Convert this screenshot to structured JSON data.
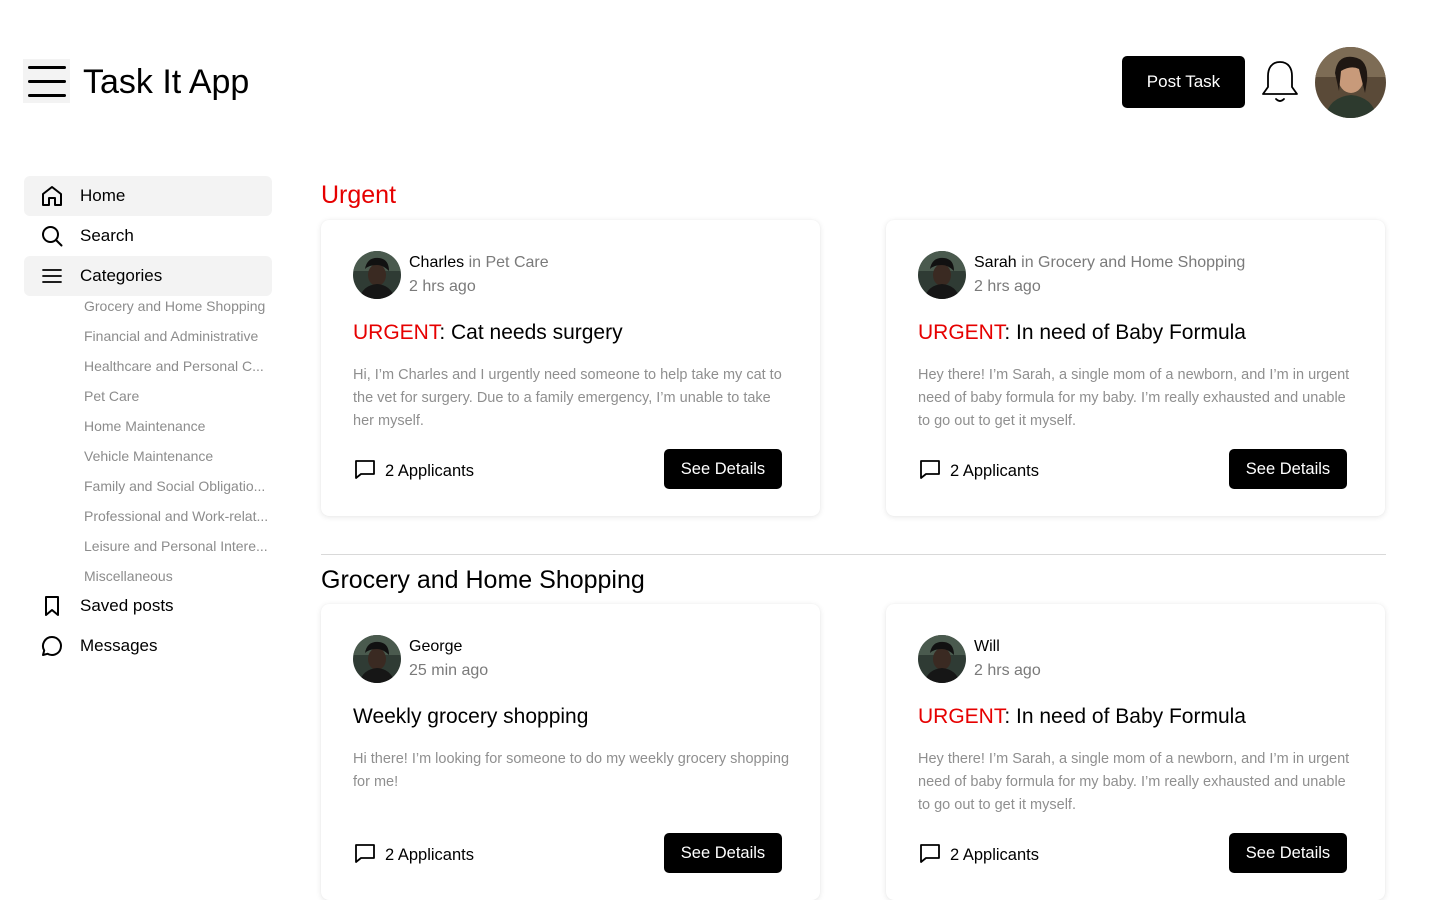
{
  "app": {
    "title": "Task It App"
  },
  "header": {
    "post_task_label": "Post Task"
  },
  "sidebar": {
    "items": [
      {
        "label": "Home",
        "icon": "home-icon"
      },
      {
        "label": "Search",
        "icon": "search-icon"
      },
      {
        "label": "Categories",
        "icon": "menu-icon"
      },
      {
        "label": "Saved posts",
        "icon": "bookmark-icon"
      },
      {
        "label": "Messages",
        "icon": "message-icon"
      }
    ],
    "categories": [
      "Grocery and Home Shopping",
      "Financial and Administrative",
      "Healthcare and Personal C...",
      "Pet Care",
      "Home Maintenance",
      "Vehicle Maintenance",
      "Family and Social Obligatio...",
      "Professional and Work-relat...",
      "Leisure and Personal Intere...",
      "Miscellaneous"
    ]
  },
  "sections": [
    {
      "title": "Urgent",
      "cards": [
        {
          "name": "Charles",
          "category": " in Pet Care",
          "time": "2 hrs ago",
          "urgent_prefix": "URGENT",
          "title": ": Cat needs surgery",
          "description": "Hi, I’m Charles and I urgently need someone to help take my cat to the vet for surgery. Due to a family emergency, I’m unable to take her myself.",
          "applicants": "2 Applicants",
          "button": "See Details"
        },
        {
          "name": "Sarah",
          "category": " in Grocery and Home Shopping",
          "time": "2 hrs ago",
          "urgent_prefix": "URGENT",
          "title": ": In need of Baby Formula",
          "description": "Hey there! I’m Sarah, a single mom of a newborn, and I’m in urgent need of baby formula for my baby. I’m really exhausted and unable to go out to get it myself.",
          "applicants": "2 Applicants",
          "button": "See Details"
        }
      ]
    },
    {
      "title": "Grocery and Home Shopping",
      "cards": [
        {
          "name": "George",
          "category": "",
          "time": "25 min ago",
          "urgent_prefix": "",
          "title": "Weekly grocery shopping",
          "description": "Hi there! I’m looking for someone to do my weekly grocery shopping for me!",
          "applicants": "2 Applicants",
          "button": "See Details"
        },
        {
          "name": "Will",
          "category": "",
          "time": "2 hrs ago",
          "urgent_prefix": "URGENT",
          "title": ": In need of Baby Formula",
          "description": "Hey there! I’m Sarah, a single mom of a newborn, and I’m in urgent need of baby formula for my baby. I’m really exhausted and unable to go out to get it myself.",
          "applicants": "2 Applicants",
          "button": "See Details"
        }
      ]
    }
  ],
  "colors": {
    "accent": "#000000",
    "urgent": "#e60000",
    "muted": "#8f8f8f"
  }
}
